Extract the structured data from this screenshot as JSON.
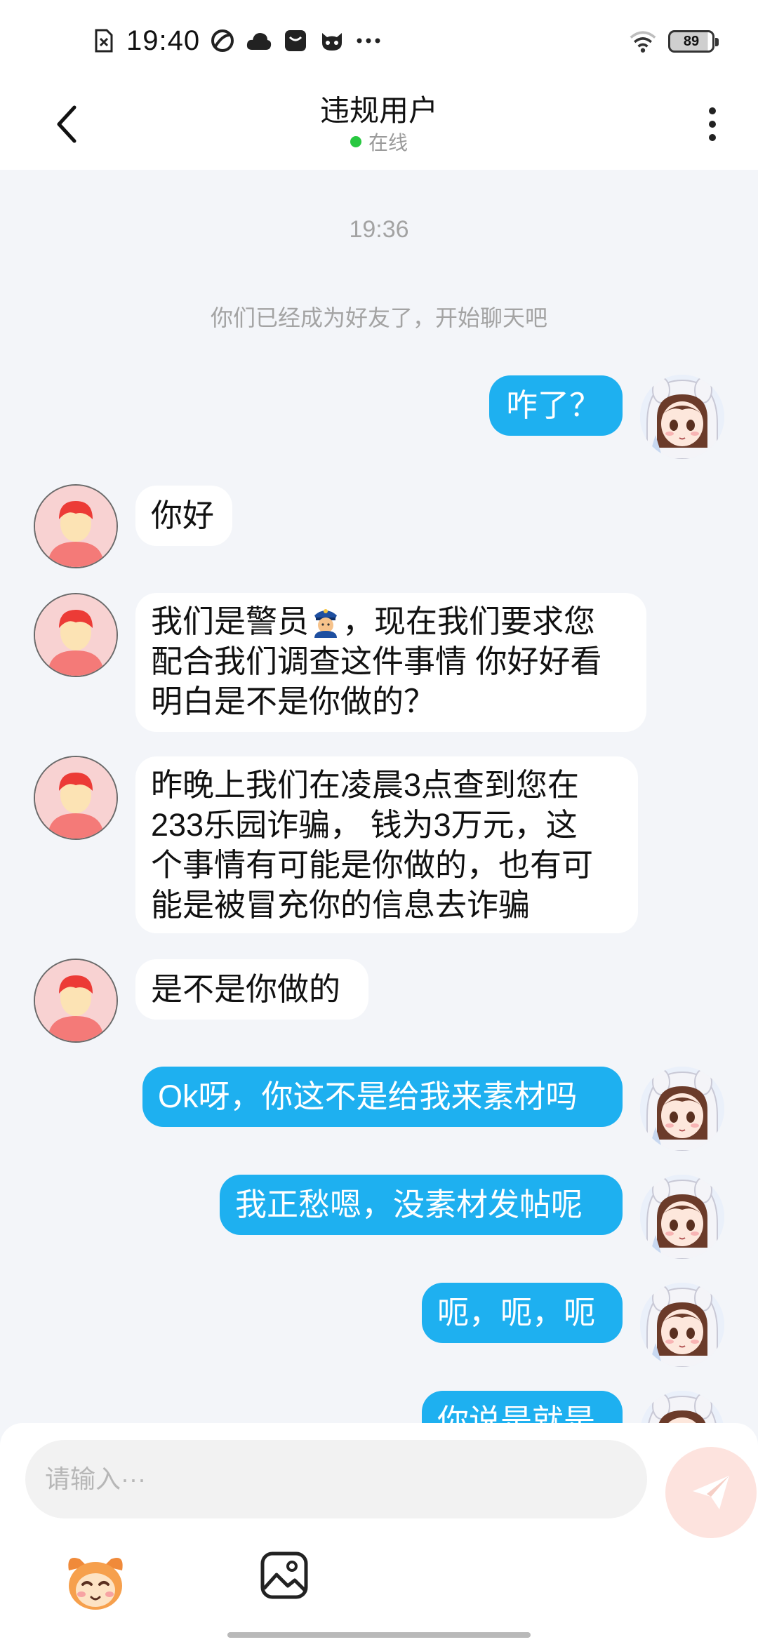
{
  "status_bar": {
    "time": "19:40",
    "battery": "89",
    "left_icons": [
      "sim-off-icon",
      "swirl-app-icon",
      "cloud-app-icon",
      "inbox-app-icon",
      "cat-app-icon",
      "more-dots-icon"
    ],
    "right_icons": [
      "wifi-icon",
      "battery-icon"
    ]
  },
  "header": {
    "title": "违规用户",
    "status": "在线",
    "status_color": "#28c840"
  },
  "chat": {
    "time": "19:36",
    "system_message": "你们已经成为好友了，开始聊天吧",
    "messages": [
      {
        "side": "right",
        "text": "咋了？"
      },
      {
        "side": "left",
        "text": "你好"
      },
      {
        "side": "left",
        "line1a": "我们是警员",
        "line1b": "，现在我们要求您",
        "line2": "配合我们调查这件事情 你好好看",
        "line3": "明白是不是你做的？"
      },
      {
        "side": "left",
        "line1": "昨晚上我们在凌晨3点查到您在",
        "line2": "233乐园诈骗， 钱为3万元，这",
        "line3": "个事情有可能是你做的，也有可",
        "line4": "能是被冒充你的信息去诈骗"
      },
      {
        "side": "left",
        "text": "是不是你做的"
      },
      {
        "side": "right",
        "text": "Ok呀，你这不是给我来素材吗"
      },
      {
        "side": "right",
        "text": "我正愁嗯，没素材发帖呢"
      },
      {
        "side": "right",
        "text": "呃，呃，呃"
      },
      {
        "side": "right",
        "text": "你说是就是"
      }
    ]
  },
  "input": {
    "placeholder": "请输入···",
    "value": ""
  },
  "colors": {
    "bubble_self": "#1eb0f0",
    "bubble_other": "#ffffff",
    "background": "#f3f5f9",
    "send_button": "#fde3de"
  }
}
